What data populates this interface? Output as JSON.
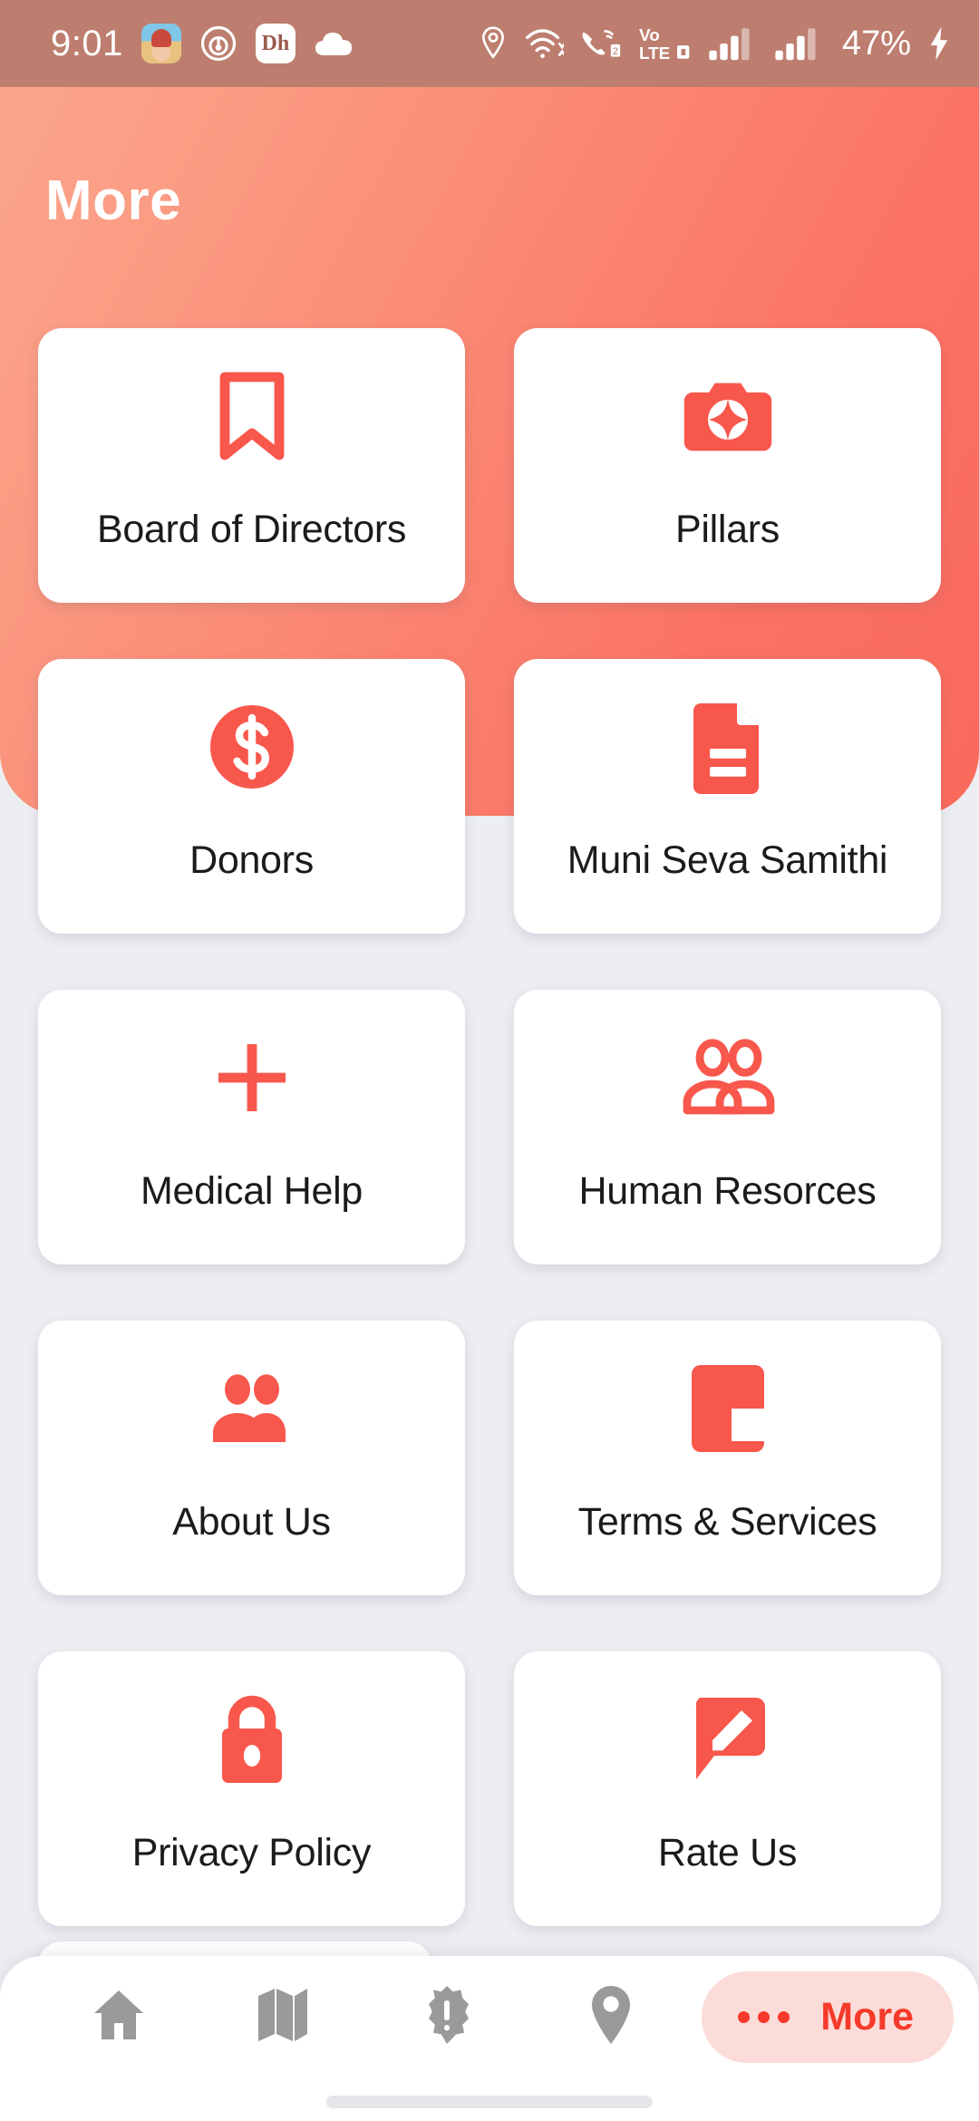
{
  "status_bar": {
    "time": "9:01",
    "battery_percent": "47%",
    "left_icons": [
      "game-app-icon",
      "cast-icon",
      "dh-app-icon",
      "cloud-icon"
    ],
    "dh_icon_text": "Dh",
    "right_icons": [
      "location-icon",
      "wifi-icon",
      "call-wifi-icon",
      "volte-icon",
      "signal-bars-sim1-icon",
      "signal-bars-sim2-icon",
      "charging-bolt-icon"
    ],
    "volte_line1": "Vo",
    "volte_line2": "LTE",
    "background": "#bd7e6f"
  },
  "header": {
    "title": "More",
    "gradient_from": "#fba98e",
    "gradient_to": "#fa6a5c"
  },
  "theme": {
    "accent": "#f8574c",
    "accent_strong": "#f5392a",
    "pill_background": "#fbdcd8",
    "page_background": "#eceef2",
    "card_background": "#ffffff",
    "label_color": "#1b1b1b",
    "nav_inactive": "#9a9a9a"
  },
  "grid": {
    "items": [
      {
        "label": "Board of Directors",
        "icon": "bookmark-icon"
      },
      {
        "label": "Pillars",
        "icon": "camera-star-icon"
      },
      {
        "label": "Donors",
        "icon": "dollar-circle-icon"
      },
      {
        "label": "Muni Seva Samithi",
        "icon": "document-icon"
      },
      {
        "label": "Medical Help",
        "icon": "plus-icon"
      },
      {
        "label": "Human Resorces",
        "icon": "people-outline-icon"
      },
      {
        "label": "About Us",
        "icon": "people-filled-icon"
      },
      {
        "label": "Terms & Services",
        "icon": "terms-block-icon"
      },
      {
        "label": "Privacy Policy",
        "icon": "lock-icon"
      },
      {
        "label": "Rate Us",
        "icon": "review-pencil-icon"
      }
    ]
  },
  "bottom_nav": {
    "items": [
      {
        "name": "home",
        "icon": "home-icon",
        "active": false
      },
      {
        "name": "map",
        "icon": "map-icon",
        "active": false
      },
      {
        "name": "alerts",
        "icon": "alert-badge-icon",
        "active": false
      },
      {
        "name": "location",
        "icon": "location-pin-icon",
        "active": false
      }
    ],
    "more": {
      "label": "More",
      "icon": "ellipsis-icon",
      "active": true
    }
  }
}
